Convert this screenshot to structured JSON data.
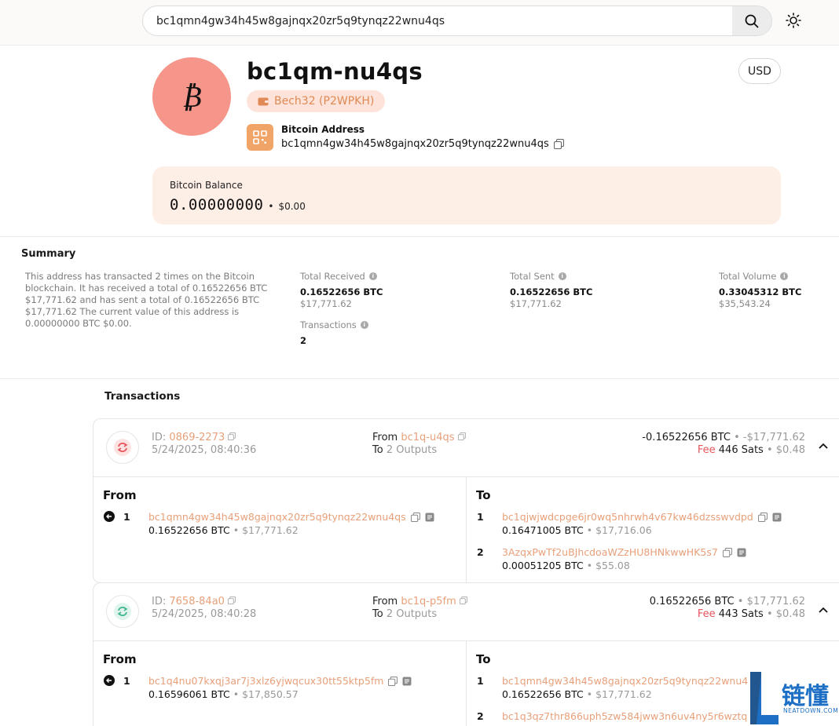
{
  "search": {
    "value": "bc1qmn4gw34h45w8gajnqx20zr5q9tynqz22wnu4qs"
  },
  "header": {
    "avatar_symbol": "₿",
    "title": "bc1qm-nu4qs",
    "type_label": "Bech32 (P2WPKH)",
    "currency": "USD",
    "address_label": "Bitcoin Address",
    "address_full": "bc1qmn4gw34h45w8gajnqx20zr5q9tynqz22wnu4qs"
  },
  "balance": {
    "label": "Bitcoin Balance",
    "btc": "0.00000000",
    "usd": "$0.00",
    "separator": "•"
  },
  "summary": {
    "title": "Summary",
    "text": "This address has transacted 2 times on the Bitcoin blockchain. It has received a total of 0.16522656 BTC $17,771.62 and has sent a total of 0.16522656 BTC $17,771.62 The current value of this address is 0.00000000 BTC $0.00.",
    "total_received": {
      "label": "Total Received",
      "btc": "0.16522656 BTC",
      "usd": "$17,771.62"
    },
    "total_sent": {
      "label": "Total Sent",
      "btc": "0.16522656 BTC",
      "usd": "$17,771.62"
    },
    "total_volume": {
      "label": "Total Volume",
      "btc": "0.33045312 BTC",
      "usd": "$35,543.24"
    },
    "transactions": {
      "label": "Transactions",
      "value": "2"
    }
  },
  "transactions_title": "Transactions",
  "transactions": [
    {
      "id_label": "ID:",
      "id": "0869-2273",
      "time": "5/24/2025, 08:40:36",
      "from_label": "From",
      "from": "bc1q-u4qs",
      "to_label": "To",
      "to": "2 Outputs",
      "amount_btc": "-0.16522656 BTC",
      "amount_usd": "-$17,771.62",
      "fee_label": "Fee",
      "fee_sats": "446 Sats",
      "fee_usd": "$0.48",
      "icon_color": "#e6545c",
      "inputs_title": "From",
      "outputs_title": "To",
      "inputs": [
        {
          "idx": "1",
          "address": "bc1qmn4gw34h45w8gajnqx20zr5q9tynqz22wnu4qs",
          "btc": "0.16522656 BTC",
          "usd": "$17,771.62"
        }
      ],
      "outputs": [
        {
          "idx": "1",
          "address": "bc1qjwjwdcpge6jr0wq5nhrwh4v67kw46dzsswvdpd",
          "btc": "0.16471005 BTC",
          "usd": "$17,716.06"
        },
        {
          "idx": "2",
          "address": "3AzqxPwTf2uBJhcdoaWZzHU8HNkwwHK5s7",
          "btc": "0.00051205 BTC",
          "usd": "$55.08"
        }
      ]
    },
    {
      "id_label": "ID:",
      "id": "7658-84a0",
      "time": "5/24/2025, 08:40:28",
      "from_label": "From",
      "from": "bc1q-p5fm",
      "to_label": "To",
      "to": "2 Outputs",
      "amount_btc": "0.16522656 BTC",
      "amount_usd": "$17,771.62",
      "fee_label": "Fee",
      "fee_sats": "443 Sats",
      "fee_usd": "$0.48",
      "icon_color": "#3fb68b",
      "inputs_title": "From",
      "outputs_title": "To",
      "inputs": [
        {
          "idx": "1",
          "address": "bc1q4nu07kxqj3ar7j3xlz6yjwqcux30tt55ktp5fm",
          "btc": "0.16596061 BTC",
          "usd": "$17,850.57"
        }
      ],
      "outputs": [
        {
          "idx": "1",
          "address": "bc1qmn4gw34h45w8gajnqx20zr5q9tynqz22wnu4",
          "btc": "0.16522656 BTC",
          "usd": "$17,771.62"
        },
        {
          "idx": "2",
          "address": "bc1q3qz7thr866uph5zw584jww3n6uv4ny5r6wztq",
          "btc": "",
          "usd": ""
        }
      ]
    }
  ],
  "watermark": {
    "text": "链懂",
    "sub": "NEATDOWN.COM"
  }
}
